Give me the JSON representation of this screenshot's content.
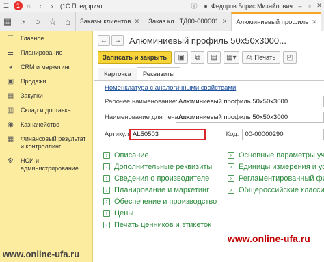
{
  "titlebar": {
    "logo": "1",
    "app_title": "(1С:Предприят...",
    "user": "Федоров Борис Михайлович",
    "icons": [
      "grid-icon",
      "home-icon",
      "back-icon",
      "forward-icon",
      "history-icon",
      "star-icon"
    ]
  },
  "tabs": [
    {
      "label": "Заказы клиентов",
      "active": false
    },
    {
      "label": "Заказ кл...ТД00-000001",
      "active": false
    },
    {
      "label": "Алюминиевый профиль",
      "active": true
    }
  ],
  "sidebar": {
    "items": [
      {
        "label": "Главное",
        "icon": "menu-icon"
      },
      {
        "label": "Планирование",
        "icon": "planning-icon"
      },
      {
        "label": "CRM и маркетинг",
        "icon": "crm-icon"
      },
      {
        "label": "Продажи",
        "icon": "sales-icon"
      },
      {
        "label": "Закупки",
        "icon": "purchases-icon"
      },
      {
        "label": "Склад и доставка",
        "icon": "warehouse-icon"
      },
      {
        "label": "Казначейство",
        "icon": "treasury-icon"
      },
      {
        "label": "Финансовый результат и контроллинг",
        "icon": "finance-icon"
      },
      {
        "label": "НСИ и администрирование",
        "icon": "settings-icon"
      }
    ]
  },
  "form": {
    "title": "Алюминиевый профиль 50х50х3000...",
    "toolbar": {
      "save_close": "Записать и закрыть",
      "print": "Печать"
    },
    "tabs": [
      {
        "label": "Карточка",
        "active": false
      },
      {
        "label": "Реквизиты",
        "active": true
      }
    ],
    "link": "Номенклатура с аналогичными свойствами",
    "fields": {
      "work_name_label": "Рабочее наименование:",
      "work_name_value": "Алюминиевый профиль 50х50х3000",
      "print_name_label": "Наименование для печати:",
      "print_name_value": "Алюминиевый профиль 50х50х3000",
      "article_label": "Артикул:",
      "article_value": "AL50503",
      "code_label": "Код:",
      "code_value": "00-00000290"
    },
    "groups_left": [
      "Описание",
      "Дополнительные реквизиты",
      "Сведения о производителе",
      "Планирование и маркетинг",
      "Обеспечение и производство",
      "Цены",
      "Печать ценников и этикеток"
    ],
    "groups_right": [
      "Основные параметры учета",
      "Единицы измерения и усл...",
      "Регламентированный фин...",
      "Общероссийские классиф..."
    ]
  },
  "watermark": {
    "right": "www.online-ufa.ru",
    "left": "www.online-ufa.ru"
  },
  "colors": {
    "sidebar_bg": "#fbeca0",
    "primary_button": "#f7d53a",
    "group_link": "#2d8a3e",
    "highlight_border": "#d9272e",
    "watermark_red": "#c00000"
  }
}
